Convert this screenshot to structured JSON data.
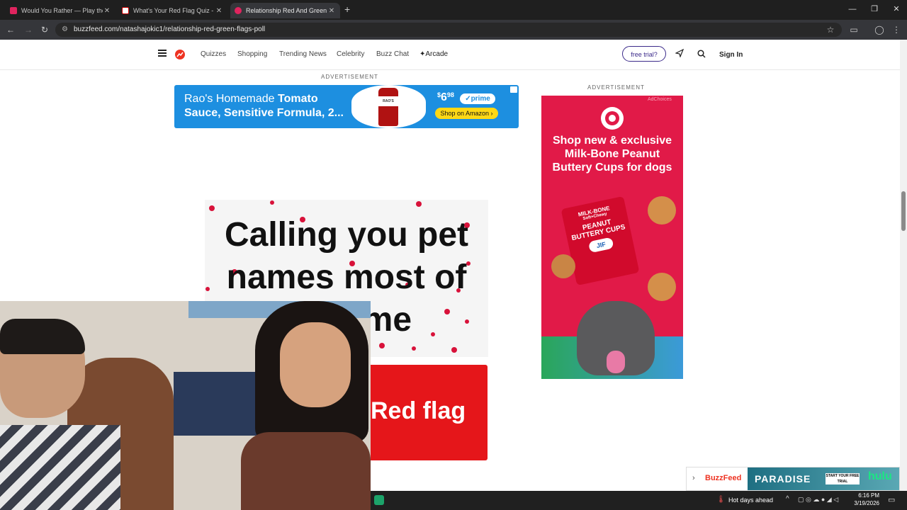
{
  "browser": {
    "tabs": [
      {
        "title": "Would You Rather — Play the G",
        "color": "#e0245e",
        "active": false
      },
      {
        "title": "What's Your Red Flag Quiz - wi",
        "color": "#ffffff",
        "active": false
      },
      {
        "title": "Relationship Red And Green Fla",
        "color": "#e0245e",
        "active": true
      }
    ],
    "new_tab": "+",
    "url": "buzzfeed.com/natashajokic1/relationship-red-green-flags-poll"
  },
  "site": {
    "menu": [
      "Quizzes",
      "Shopping",
      "Trending News",
      "Celebrity",
      "Buzz Chat",
      "Arcade"
    ],
    "arcade_prefix": "✦",
    "trial": "free trial?",
    "signin": "Sign In"
  },
  "ads": {
    "label": "ADVERTISEMENT",
    "banner": {
      "line1_plain": "Rao's Homemade ",
      "line1_bold": "Tomato",
      "line2": "Sauce, Sensitive Formula, 2...",
      "price_dollar": "$",
      "price_main": "6",
      "price_cents": "98",
      "prime": "✓prime",
      "shop": "Shop on Amazon ›",
      "jar": "RAO'S"
    },
    "tower": {
      "adchoices": "AdChoices",
      "headline": "Shop new & exclusive Milk-Bone Peanut Buttery Cups for dogs",
      "bag_brand": "MILK-BONE",
      "bag_sub": "Soft+Chewy",
      "bag_title": "PEANUT BUTTERY CUPS",
      "bag_jif": "JIF"
    }
  },
  "quiz": {
    "question": "Calling you pet names most of the time",
    "red_flag": "Red flag"
  },
  "footer_ad": {
    "brand": "BuzzFeed",
    "promo": "PARADISE",
    "service": "hulu",
    "cta": "START YOUR FREE TRIAL"
  },
  "taskbar": {
    "weather": "Hot days ahead",
    "time": "6:16 PM",
    "date": "3/19/2026"
  },
  "colors": {
    "brand_red": "#e5161a",
    "buzzfeed_red": "#ee3322",
    "target_red": "#e11a48",
    "amazon_blue": "#1d8fe0",
    "hulu_green": "#1ce783"
  }
}
